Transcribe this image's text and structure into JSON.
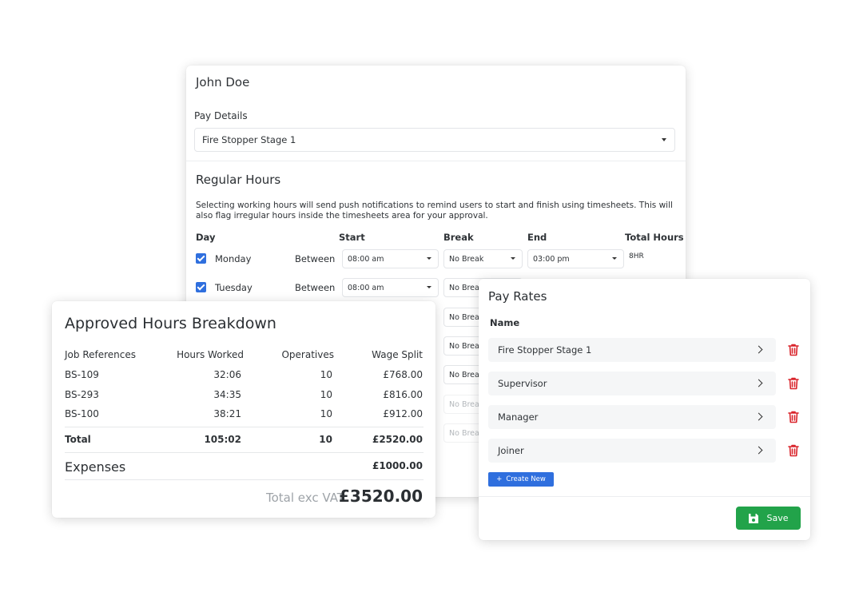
{
  "employee": {
    "name": "John Doe"
  },
  "pay_details": {
    "label": "Pay Details",
    "selected": "Fire Stopper Stage 1"
  },
  "regular_hours": {
    "title": "Regular Hours",
    "description": "Selecting working hours will send push notifications to remind users to start and finish using timesheets. This will also flag irregular hours inside the timesheets area for your approval.",
    "columns": {
      "day": "Day",
      "start": "Start",
      "break": "Break",
      "end": "End",
      "total": "Total Hours"
    },
    "between_label": "Between",
    "days": [
      {
        "day": "Monday",
        "start": "08:00 am",
        "break": "No Break",
        "end": "03:00 pm",
        "total": "8HR"
      },
      {
        "day": "Tuesday",
        "start": "08:00 am",
        "break": "No Break"
      }
    ],
    "hidden_breaks": [
      "No Break",
      "No Break",
      "No Break",
      "No Break",
      "No Break"
    ]
  },
  "approved_hours": {
    "title": "Approved Hours Breakdown",
    "headers": {
      "job": "Job References",
      "hours": "Hours Worked",
      "operatives": "Operatives",
      "wage": "Wage Split"
    },
    "rows": [
      {
        "job": "BS-109",
        "hours": "32:06",
        "operatives": "10",
        "wage": "£768.00"
      },
      {
        "job": "BS-293",
        "hours": "34:35",
        "operatives": "10",
        "wage": "£816.00"
      },
      {
        "job": "BS-100",
        "hours": "38:21",
        "operatives": "10",
        "wage": "£912.00"
      }
    ],
    "total": {
      "label": "Total",
      "hours": "105:02",
      "operatives": "10",
      "wage": "£2520.00"
    },
    "expenses": {
      "label": "Expenses",
      "value": "£1000.00"
    },
    "vat": {
      "label": "Total exc VAT:",
      "value": "£3520.00"
    }
  },
  "pay_rates": {
    "title": "Pay Rates",
    "name_header": "Name",
    "items": [
      "Fire Stopper Stage 1",
      "Supervisor",
      "Manager",
      "Joiner"
    ],
    "create_label": "Create New",
    "save_label": "Save"
  },
  "colors": {
    "primary": "#2f6fde",
    "success": "#22a34a",
    "danger": "#d9242b"
  },
  "icons": [
    "checkbox-checked-icon",
    "caret-down-icon",
    "chevron-right-icon",
    "trash-icon",
    "plus-icon",
    "save-icon"
  ]
}
